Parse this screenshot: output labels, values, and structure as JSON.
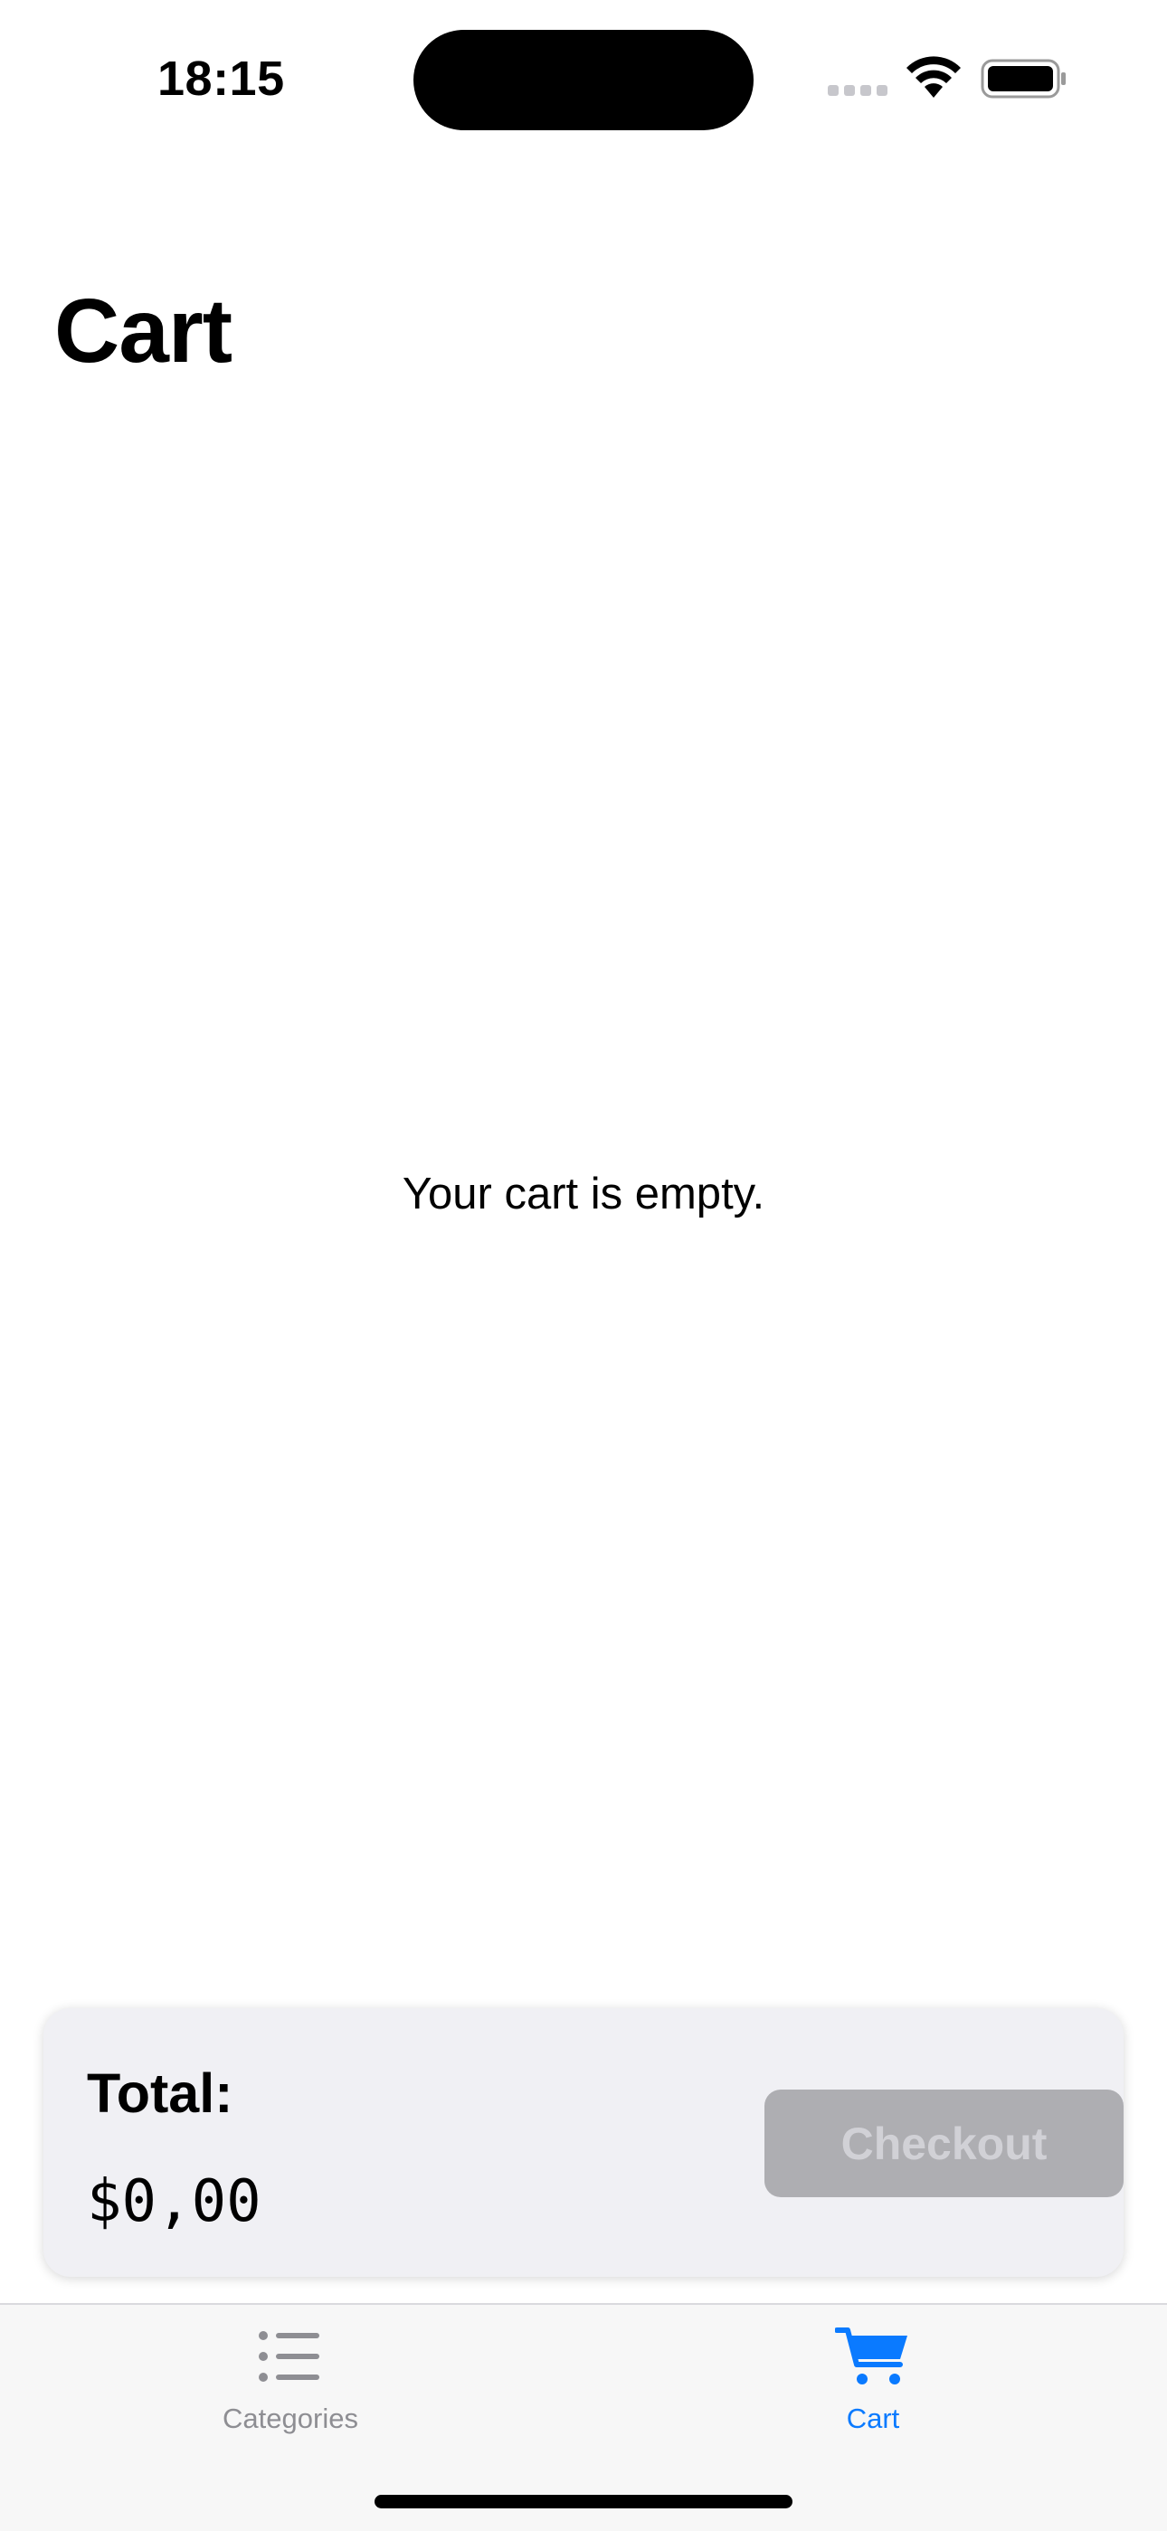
{
  "status_bar": {
    "time": "18:15"
  },
  "header": {
    "title": "Cart"
  },
  "main": {
    "empty_message": "Your cart is empty."
  },
  "summary": {
    "total_label": "Total:",
    "total_value": "$0,00",
    "checkout_label": "Checkout",
    "checkout_enabled": false
  },
  "tab_bar": {
    "tabs": [
      {
        "label": "Categories",
        "icon": "list-bullet-icon",
        "selected": false
      },
      {
        "label": "Cart",
        "icon": "cart-icon",
        "selected": true
      }
    ]
  },
  "colors": {
    "accent": "#0a7aff",
    "inactive_tab": "#8e8e93",
    "card_background": "#f0f0f4",
    "disabled_button": "#aeaeb2"
  }
}
